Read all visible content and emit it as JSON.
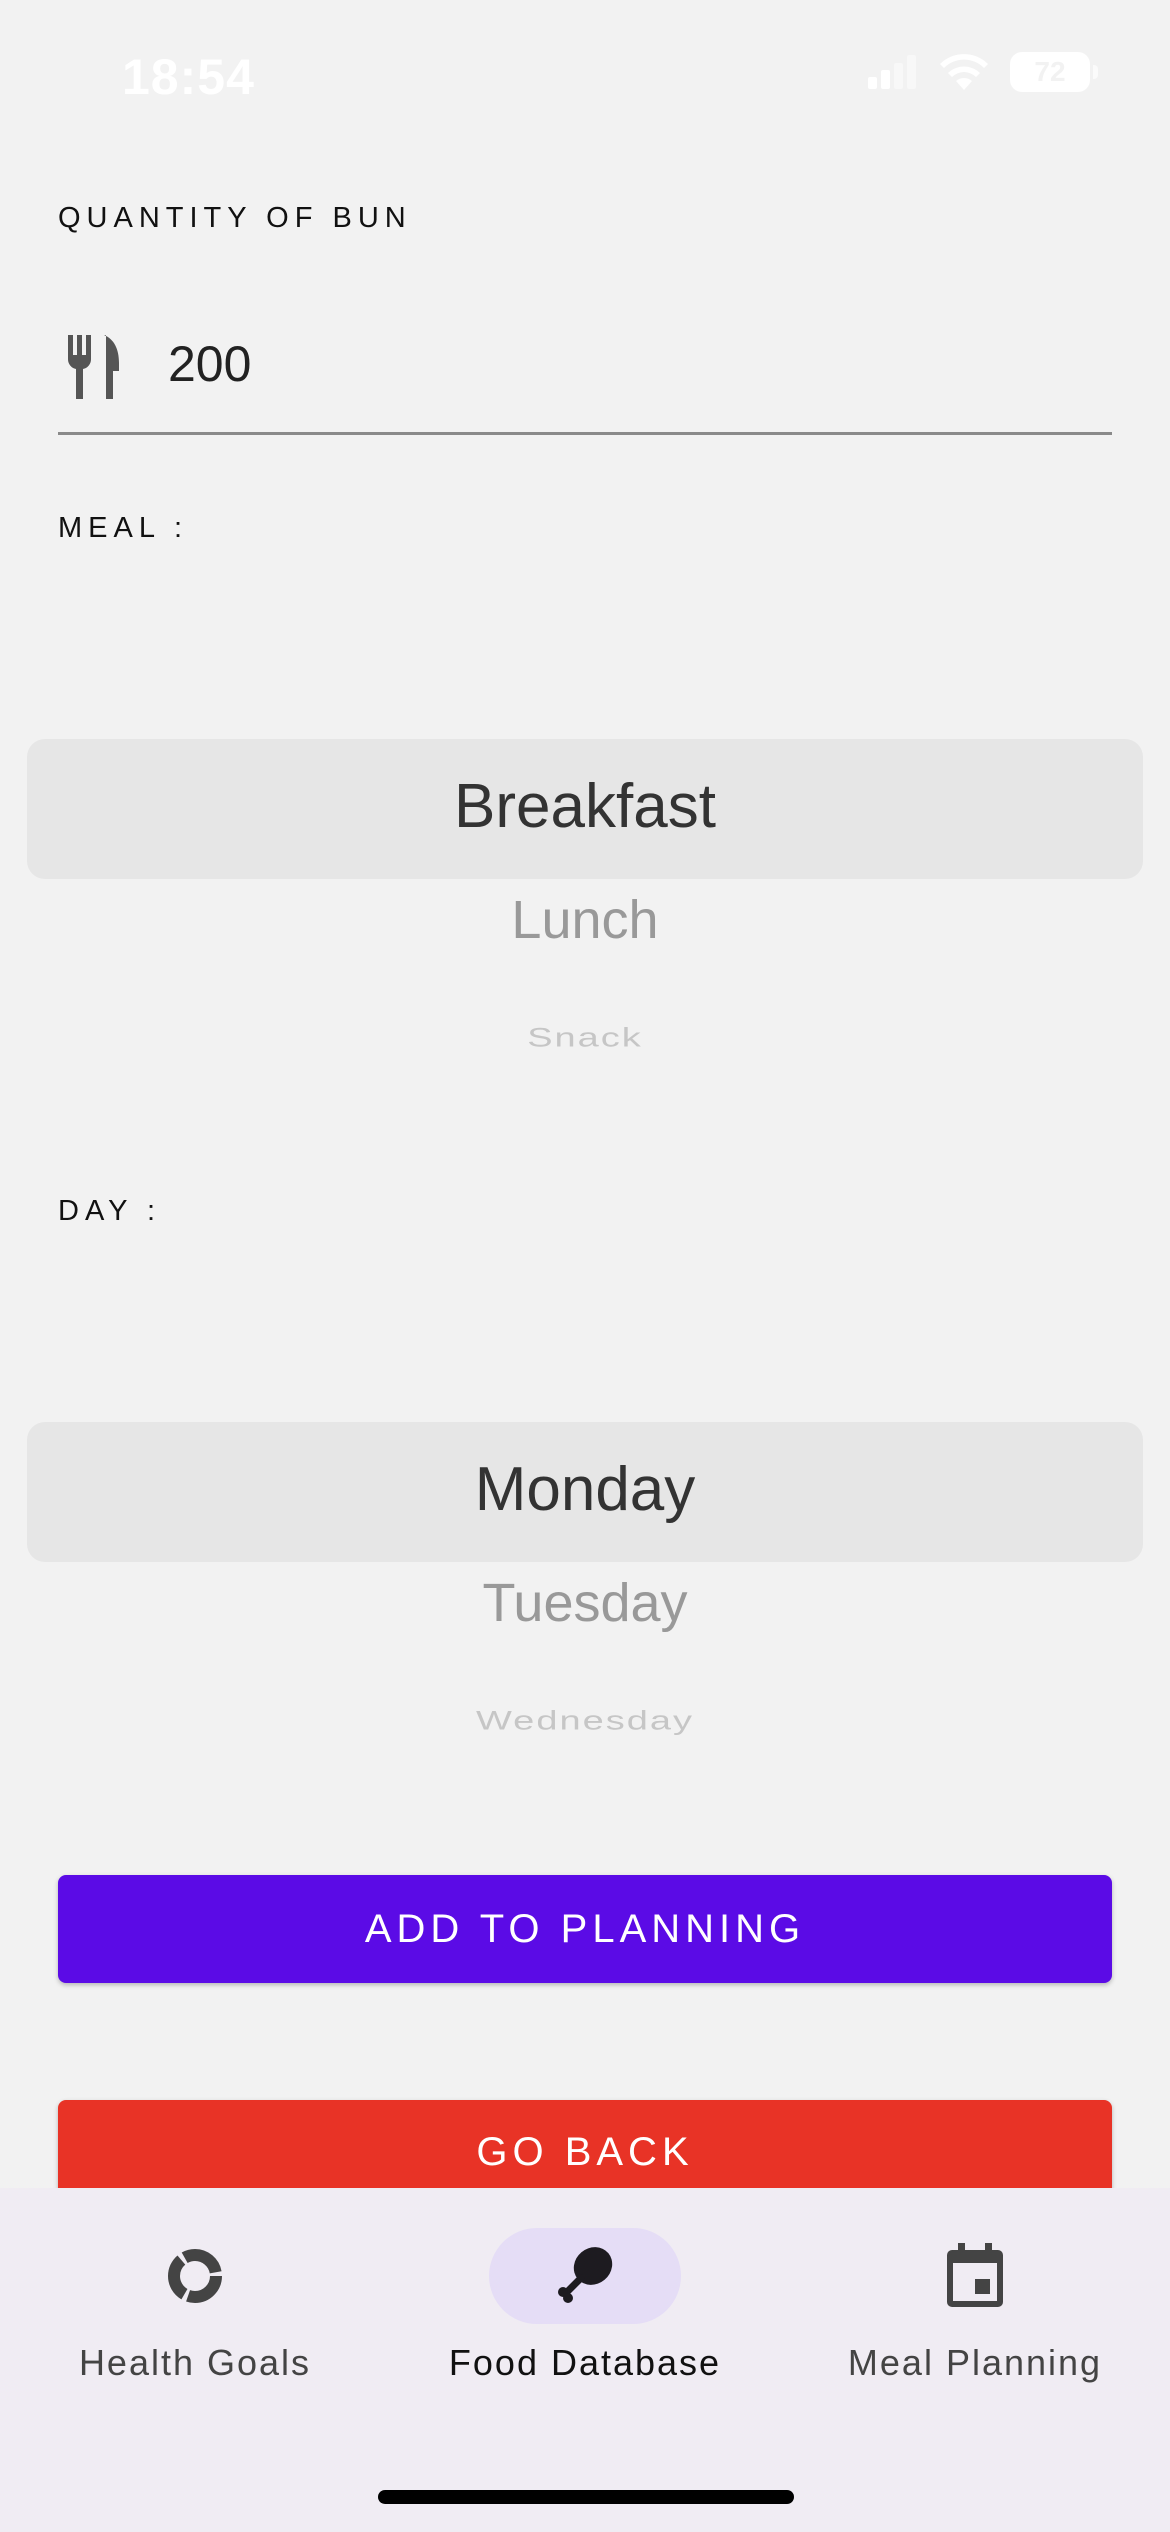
{
  "status_bar": {
    "time": "18:54",
    "battery": "72"
  },
  "quantity": {
    "label": "QUANTITY OF BUN",
    "value": "200",
    "icon": "fork-knife-icon"
  },
  "meal": {
    "label": "MEAL :",
    "selected": "Breakfast",
    "options_below": [
      "Lunch",
      "Snack"
    ]
  },
  "day": {
    "label": "DAY :",
    "selected": "Monday",
    "options_below": [
      "Tuesday",
      "Wednesday"
    ]
  },
  "actions": {
    "add_label": "ADD TO PLANNING",
    "back_label": "GO BACK",
    "add_color": "#5b0be6",
    "back_color": "#e83326"
  },
  "bottom_nav": {
    "items": [
      {
        "label": "Health Goals",
        "icon": "donut-chart-icon",
        "active": false
      },
      {
        "label": "Food Database",
        "icon": "drumstick-icon",
        "active": true
      },
      {
        "label": "Meal Planning",
        "icon": "calendar-icon",
        "active": false
      }
    ]
  }
}
